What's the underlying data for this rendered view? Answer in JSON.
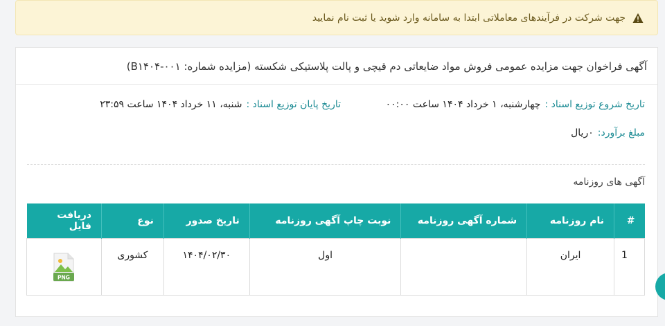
{
  "alert": {
    "icon": "warning-icon",
    "text": "جهت شرکت در فرآیندهای معاملاتی ابتدا به سامانه وارد شوید یا ثبت نام نمایید"
  },
  "announcement": {
    "title": "آگهی فراخوان جهت مزایده عمومی فروش مواد ضایعاتی دم قیچی و پالت پلاستیکی شکسته (مزایده شماره: B۱۴۰۴-۰۰۱)",
    "start_label": "تاریخ شروع توزیع اسناد :",
    "start_value": "چهارشنبه، ۱ خرداد ۱۴۰۴ ساعت ۰۰:۰۰",
    "end_label": "تاریخ پایان توزیع اسناد :",
    "end_value": "شنبه، ۱۱ خرداد ۱۴۰۴ ساعت ۲۳:۵۹",
    "estimate_label": "مبلغ برآورد:",
    "estimate_value": "۰ریال"
  },
  "newspapers": {
    "section_title": "آگهی های روزنامه",
    "columns": [
      "#",
      "نام روزنامه",
      "شماره آگهی روزنامه",
      "نوبت چاپ آگهی روزنامه",
      "تاریخ صدور",
      "نوع",
      "دریافت فایل"
    ],
    "rows": [
      {
        "index": "1",
        "name": "ایران",
        "ad_number": "",
        "print_turn": "اول",
        "issue_date": "۱۴۰۴/۰۲/۳۰",
        "type": "کشوری",
        "file_icon": "png-file-icon",
        "file_badge": "PNG"
      }
    ]
  },
  "colors": {
    "accent": "#17a9a6",
    "label": "#1a8a93",
    "alert_bg": "#fcf4d6"
  }
}
